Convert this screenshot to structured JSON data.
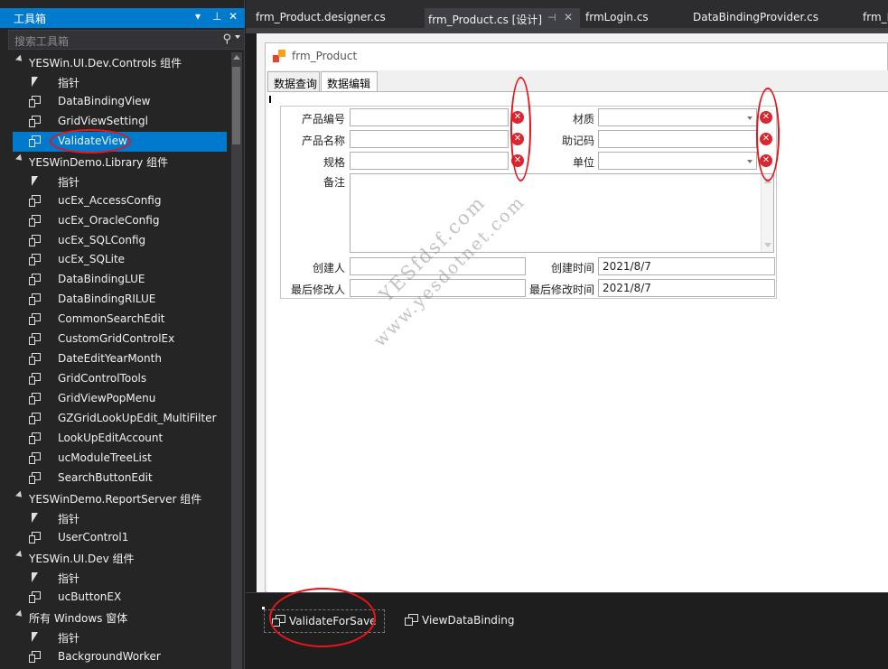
{
  "toolbox": {
    "title": "工具箱",
    "controls": {
      "dropdown": "▾",
      "pin": "⊥",
      "close": "✕"
    },
    "search_placeholder": "搜索工具箱",
    "groups": [
      {
        "label": "YESWin.UI.Dev.Controls 组件",
        "items": [
          "指针",
          "DataBindingView",
          "GridViewSettingl",
          "ValidateView"
        ]
      },
      {
        "label": "YESWinDemo.Library 组件",
        "items": [
          "指针",
          "ucEx_AccessConfig",
          "ucEx_OracleConfig",
          "ucEx_SQLConfig",
          "ucEx_SQLite",
          "DataBindingLUE",
          "DataBindingRILUE",
          "CommonSearchEdit",
          "CustomGridControlEx",
          "DateEditYearMonth",
          "GridControlTools",
          "GridViewPopMenu",
          "GZGridLookUpEdit_MultiFilter",
          "LookUpEditAccount",
          "ucModuleTreeList",
          "SearchButtonEdit"
        ]
      },
      {
        "label": "YESWinDemo.ReportServer 组件",
        "items": [
          "指针",
          "UserControl1"
        ]
      },
      {
        "label": "YESWin.UI.Dev 组件",
        "items": [
          "指针",
          "ucButtonEX"
        ]
      },
      {
        "label": "所有 Windows 窗体",
        "items": [
          "指针",
          "BackgroundWorker"
        ]
      }
    ],
    "selected_item": "ValidateView"
  },
  "tabs": [
    {
      "label": "frm_Product.designer.cs"
    },
    {
      "label": "frm_Product.cs [设计]",
      "active": true,
      "pin": "⊣",
      "close": "✕"
    },
    {
      "label": "frmLogin.cs"
    },
    {
      "label": "DataBindingProvider.cs"
    },
    {
      "label": "frm_P"
    }
  ],
  "form": {
    "title": "frm_Product",
    "tabs": [
      "数据查询",
      "数据编辑"
    ],
    "active_tab": "数据编辑",
    "fields": {
      "product_code": {
        "label": "产品编号",
        "value": ""
      },
      "material": {
        "label": "材质",
        "value": ""
      },
      "product_name": {
        "label": "产品名称",
        "value": ""
      },
      "mnemonic": {
        "label": "助记码",
        "value": ""
      },
      "spec": {
        "label": "规格",
        "value": ""
      },
      "unit": {
        "label": "单位",
        "value": ""
      },
      "remark": {
        "label": "备注",
        "value": ""
      },
      "creator": {
        "label": "创建人",
        "value": ""
      },
      "create_time": {
        "label": "创建时间",
        "value": "2021/8/7"
      },
      "modifier": {
        "label": "最后修改人",
        "value": ""
      },
      "modify_time": {
        "label": "最后修改时间",
        "value": "2021/8/7"
      }
    },
    "error_icon": "✕"
  },
  "watermark": {
    "line1": "YESfdsf.com",
    "line2": "www.yesdotnet.com"
  },
  "tray": {
    "items": [
      "ValidateForSave",
      "ViewDataBinding"
    ],
    "selected": "ValidateForSave"
  },
  "colors": {
    "accent": "#007acc",
    "error": "#d9262f",
    "annotation": "#e8141b"
  }
}
